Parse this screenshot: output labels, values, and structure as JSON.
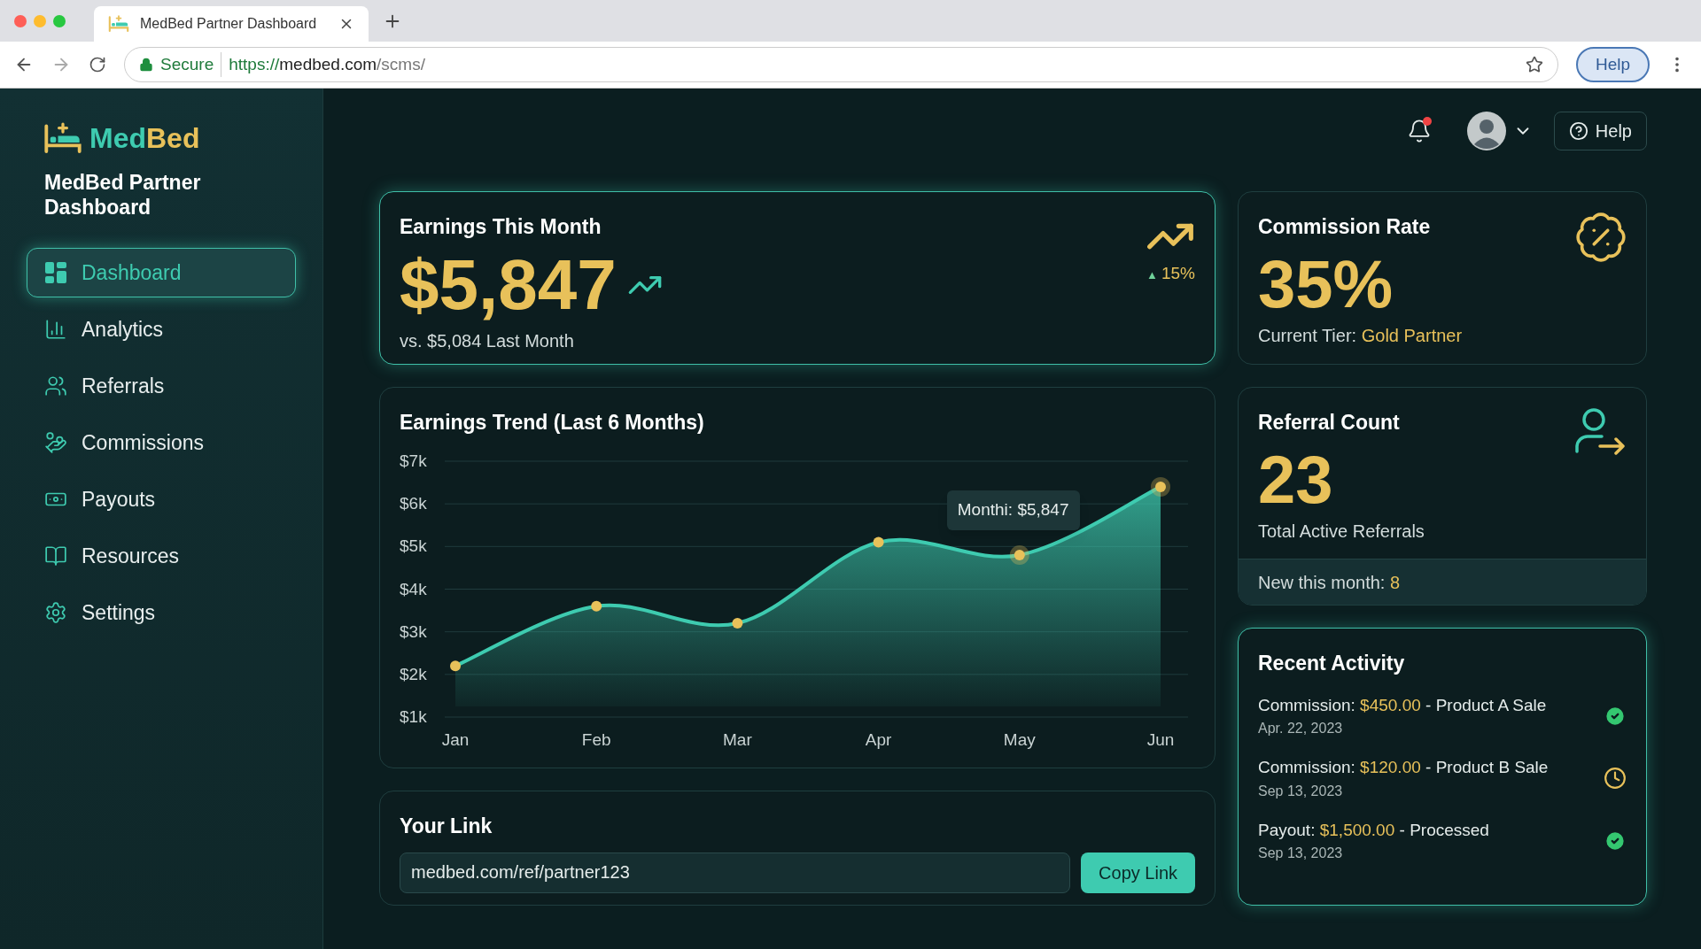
{
  "browser": {
    "tab_title": "MedBed Partner Dashboard",
    "secure_label": "Secure",
    "url_scheme": "https://",
    "url_host": "medbed.com",
    "url_path": "/scms/",
    "help_button": "Help"
  },
  "sidebar": {
    "brand_first": "Med",
    "brand_second": "Bed",
    "title": "MedBed Partner Dashboard",
    "items": [
      {
        "label": "Dashboard",
        "selected": true
      },
      {
        "label": "Analytics",
        "selected": false
      },
      {
        "label": "Referrals",
        "selected": false
      },
      {
        "label": "Commissions",
        "selected": false
      },
      {
        "label": "Payouts",
        "selected": false
      },
      {
        "label": "Resources",
        "selected": false
      },
      {
        "label": "Settings",
        "selected": false
      }
    ]
  },
  "header": {
    "notification_unread": true,
    "help_button": "Help"
  },
  "earnings_card": {
    "title": "Earnings This Month",
    "amount": "$5,847",
    "comparison": "vs. $5,084 Last Month",
    "change_arrow": "▲",
    "change": "15%"
  },
  "commission_card": {
    "title": "Commission Rate",
    "rate": "35%",
    "tier_label": "Current Tier:",
    "tier": "Gold Partner"
  },
  "referral_card": {
    "title": "Referral Count",
    "count": "23",
    "caption": "Total Active Referrals",
    "new_label": "New this month:",
    "new_count": "8"
  },
  "trend_card": {
    "tooltip": "Monthi: $5,847",
    "chart_data": {
      "type": "area",
      "grid": true,
      "title": "Earnings Trend (Last 6 Months)",
      "categories": [
        "Jan",
        "Feb",
        "Mar",
        "Apr",
        "May",
        "Jun"
      ],
      "series": [
        {
          "color": "#3ecbb0",
          "values": [
            2.2,
            3.6,
            3.2,
            5.1,
            4.8,
            6.4
          ]
        }
      ],
      "ylim": [
        1,
        7
      ],
      "yticks": [
        {
          "value": 7,
          "label": "$7k"
        },
        {
          "value": 6,
          "label": "$6k"
        },
        {
          "value": 5,
          "label": "$5k"
        },
        {
          "value": 4,
          "label": "$4k"
        },
        {
          "value": 3,
          "label": "$3k"
        },
        {
          "value": 2,
          "label": "$2k"
        },
        {
          "value": 1,
          "label": "$1k"
        }
      ]
    }
  },
  "link_card": {
    "title": "Your Link",
    "value": "medbed.com/ref/partner123",
    "button": "Copy Link"
  },
  "activity_card": {
    "title": "Recent Activity",
    "items": [
      {
        "label": "Commission:",
        "amount": "$450.00",
        "detail": "- Product A Sale",
        "date": "Apr. 22, 2023",
        "kind": "done"
      },
      {
        "label": "Commission:",
        "amount": "$120.00",
        "detail": "- Product B Sale",
        "date": "Sep 13, 2023",
        "kind": "pending"
      },
      {
        "label": "Payout:",
        "amount": "$1,500.00",
        "detail": "- Processed",
        "date": "Sep 13, 2023",
        "kind": "done"
      }
    ]
  }
}
